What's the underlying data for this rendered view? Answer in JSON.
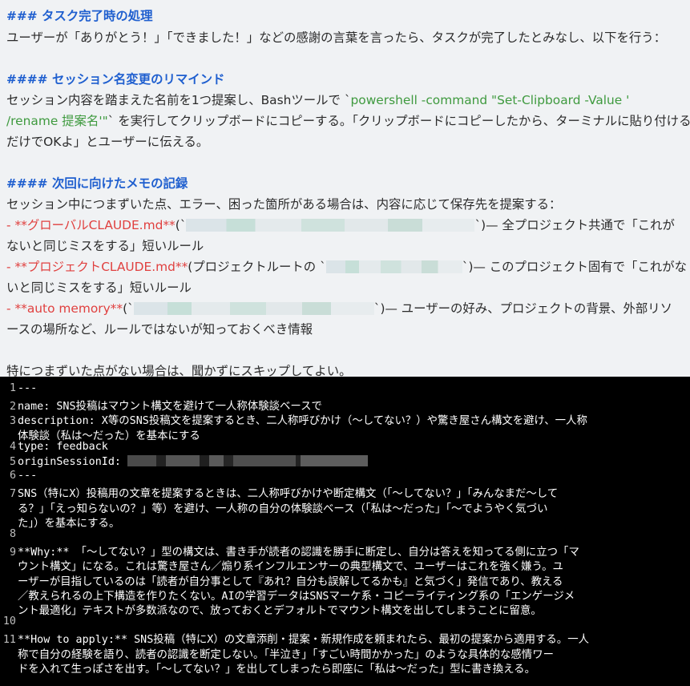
{
  "doc": {
    "h1": "### タスク完了時の処理",
    "p1": "ユーザーが「ありがとう！」「できました！」などの感謝の言葉を言ったら、タスクが完了したとみなし、以下を行う：",
    "h2": "#### セッション名変更のリマインド",
    "p2a_pre": "セッション内容を踏まえた名前を1つ提案し、Bashツールで `",
    "p2a_code": "powershell -command \"Set-Clipboard -Value '",
    "p2b_code": "/rename 提案名'\"",
    "p2b_post": "` を実行してクリップボードにコピーする。「クリップボードにコピーしたから、ターミナルに貼り付ける",
    "p2c": "だけでOKよ」とユーザーに伝える。",
    "h3": "#### 次回に向けたメモの記録",
    "p3": "セッション中につまずいた点、エラー、困った箇所がある場合は、内容に応じて保存先を提案する：",
    "b1_dash": "- ",
    "b1_label": "**グローバルCLAUDE.md**",
    "b1_open": "(`",
    "b1_close": "`)— 全プロジェクト共通で「これが",
    "b1_cont": "ないと同じミスをする」短いルール",
    "b2_dash": "- ",
    "b2_label": "**プロジェクトCLAUDE.md**",
    "b2_open": "(プロジェクトルートの `",
    "b2_close": "`)— このプロジェクト固有で「これがな",
    "b2_cont": "いと同じミスをする」短いルール",
    "b3_dash": "- ",
    "b3_label": "**auto memory**",
    "b3_open": "(`",
    "b3_close": "`)— ユーザーの好み、プロジェクトの背景、外部リソ",
    "b3_cont": "ースの場所など、ルールではないが知っておくべき情報",
    "p4": "特につまずいた点がない場合は、聞かずにスキップしてよい。"
  },
  "terminal": {
    "lines": [
      {
        "n": "1",
        "t": "---"
      },
      {
        "n": "2",
        "t": "name: SNS投稿はマウント構文を避けて一人称体験談ベースで"
      },
      {
        "n": "3",
        "t": "description: X等のSNS投稿文を提案するとき、二人称呼びかけ（〜してない？）や驚き屋さん構文を避け、一人称"
      },
      {
        "n": "",
        "t": "体験談（私は〜だった）を基本にする"
      },
      {
        "n": "4",
        "t": "type: feedback"
      },
      {
        "n": "5",
        "t": "originSessionId: "
      },
      {
        "n": "6",
        "t": "---"
      },
      {
        "n": "7",
        "t": "SNS（特にX）投稿用の文章を提案するときは、二人称呼びかけや断定構文（「〜してない？」「みんなまだ〜して"
      },
      {
        "n": "",
        "t": "る？」「えっ知らないの？」等）を避け、一人称の自分の体験談ベース（「私は〜だった」「〜でようやく気づい"
      },
      {
        "n": "",
        "t": "た」）を基本にする。"
      },
      {
        "n": "8",
        "t": ""
      },
      {
        "n": "9",
        "t": "**Why:** 「〜してない？」型の構文は、書き手が読者の認識を勝手に断定し、自分は答えを知ってる側に立つ「マ"
      },
      {
        "n": "",
        "t": "ウント構文」になる。これは驚き屋さん／煽り系インフルエンサーの典型構文で、ユーザーはこれを強く嫌う。ユ"
      },
      {
        "n": "",
        "t": "ーザーが目指しているのは「読者が自分事として『あれ？自分も誤解してるかも』と気づく」発信であり、教える"
      },
      {
        "n": "",
        "t": "／教えられるの上下構造を作りたくない。AIの学習データはSNSマーケ系・コピーライティング系の「エンゲージメ"
      },
      {
        "n": "",
        "t": "ント最適化」テキストが多数派なので、放っておくとデフォルトでマウント構文を出してしまうことに留意。"
      },
      {
        "n": "10",
        "t": ""
      },
      {
        "n": "11",
        "t": "**How to apply:** SNS投稿（特にX）の文章添削・提案・新規作成を頼まれたら、最初の提案から適用する。一人"
      },
      {
        "n": "",
        "t": "称で自分の経験を語り、読者の認識を断定しない。「半泣き」「すごい時間かかった」のような具体的な感情ワー"
      },
      {
        "n": "",
        "t": "ドを入れて生っぽさを出す。「〜してない？」を出してしまったら即座に「私は〜だった」型に書き換える。"
      }
    ]
  }
}
